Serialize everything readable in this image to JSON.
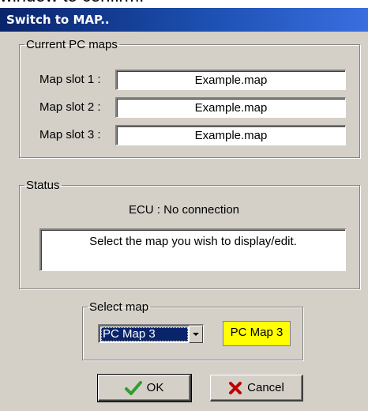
{
  "background_text": "window to confirm.",
  "window": {
    "title": "Switch to MAP.."
  },
  "current_maps": {
    "legend": "Current PC maps",
    "slots": [
      {
        "label": "Map slot 1 :",
        "value": "Example.map"
      },
      {
        "label": "Map slot 2 :",
        "value": "Example.map"
      },
      {
        "label": "Map slot 3 :",
        "value": "Example.map"
      }
    ]
  },
  "status": {
    "legend": "Status",
    "ecu": "ECU : No connection",
    "message": "Select the map you wish to display/edit."
  },
  "select_map": {
    "legend": "Select map",
    "selected": "PC Map 3",
    "indicator": "PC Map 3",
    "indicator_color": "#ffff00"
  },
  "buttons": {
    "ok": "OK",
    "cancel": "Cancel"
  },
  "icons": {
    "ok": "checkmark-icon",
    "cancel": "x-icon",
    "dropdown": "chevron-down-icon"
  },
  "colors": {
    "titlebar": "#0a246a",
    "dialog_bg": "#d4d0c8",
    "check": "#2e9e2e",
    "cross": "#c00000"
  }
}
